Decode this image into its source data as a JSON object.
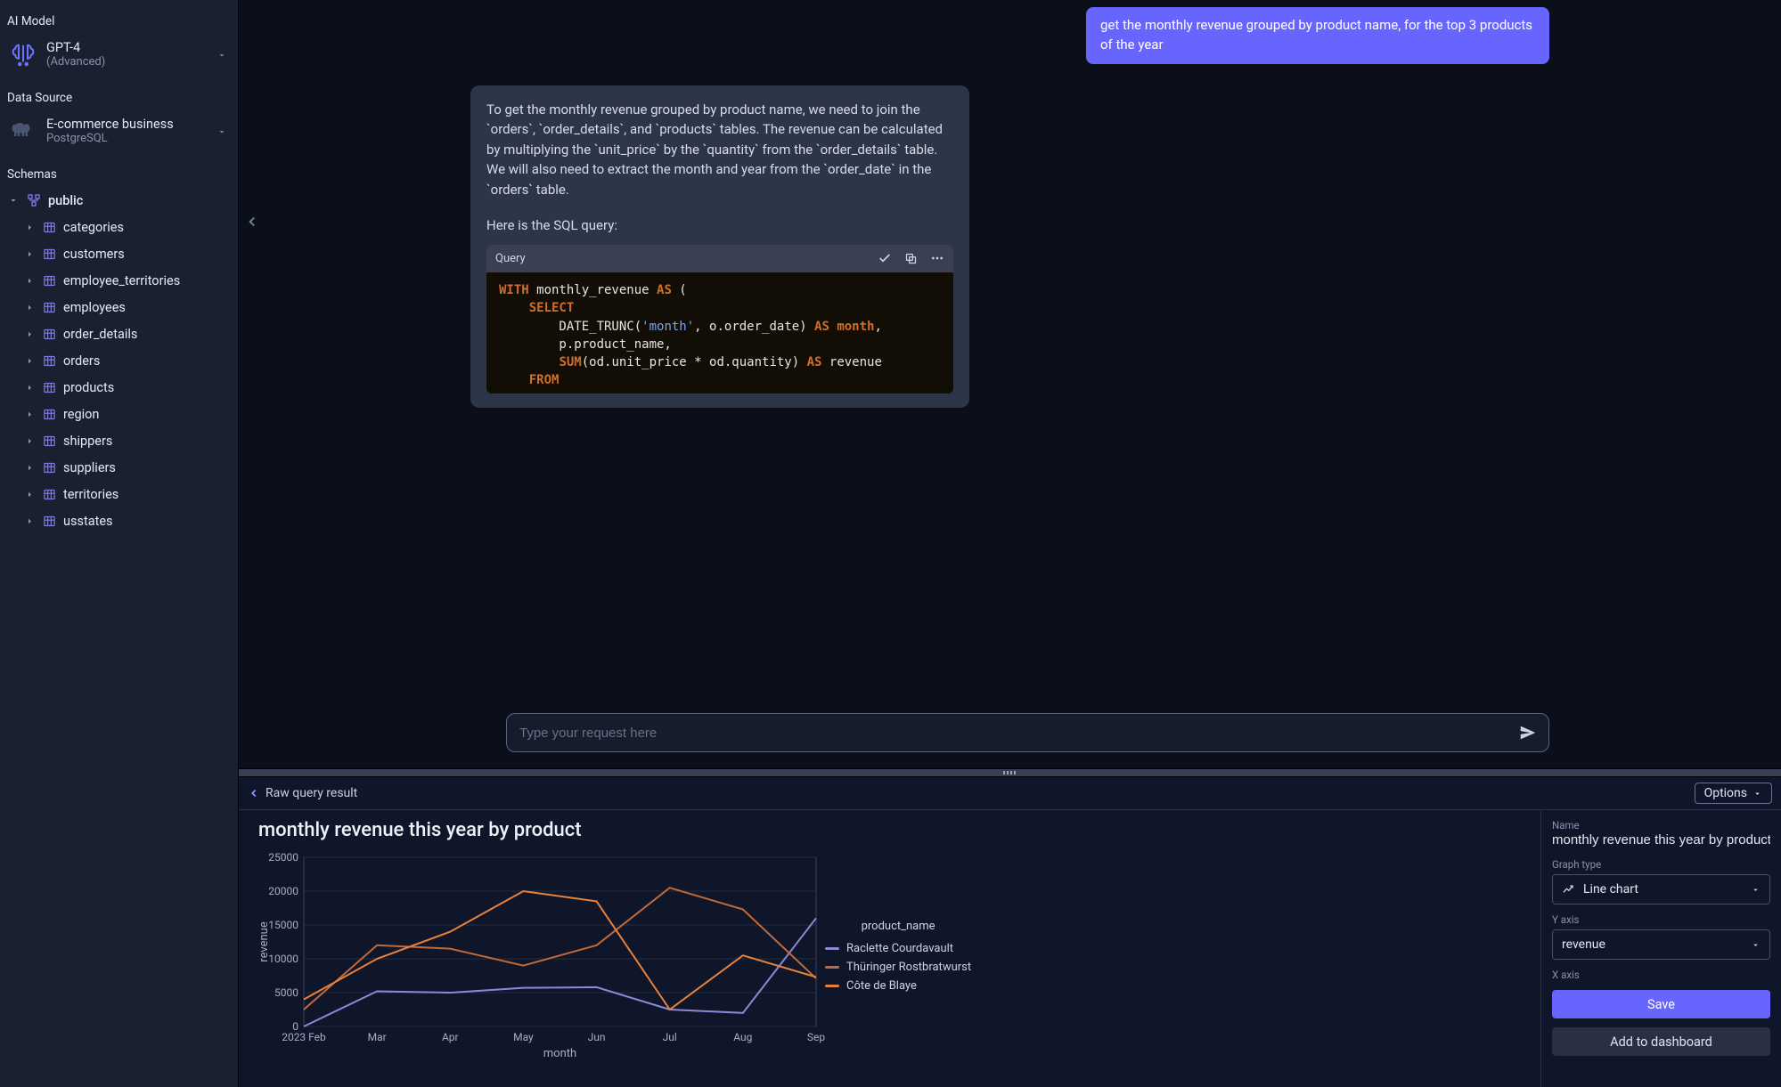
{
  "sidebar": {
    "ai_model": {
      "label": "AI Model",
      "name": "GPT-4",
      "sub": "(Advanced)"
    },
    "data_source": {
      "label": "Data Source",
      "name": "E-commerce business",
      "sub": "PostgreSQL"
    },
    "schemas": {
      "label": "Schemas",
      "schema_name": "public",
      "tables": [
        "categories",
        "customers",
        "employee_territories",
        "employees",
        "order_details",
        "orders",
        "products",
        "region",
        "shippers",
        "suppliers",
        "territories",
        "usstates"
      ]
    }
  },
  "chat": {
    "user_message": "get the monthly revenue grouped by product name, for the top 3 products of the year",
    "assistant_text_1": "To get the monthly revenue grouped by product name, we need to join the `orders`, `order_details`, and `products` tables. The revenue can be calculated by multiplying the `unit_price` by the `quantity` from the `order_details` table. We will also need to extract the month and year from the `order_date` in the `orders` table.",
    "assistant_text_2": "Here is the SQL query:",
    "query_label": "Query",
    "sql_tokens": [
      [
        "kw",
        "WITH"
      ],
      [
        "",
        " monthly_revenue "
      ],
      [
        "kw",
        "AS"
      ],
      [
        "",
        " ("
      ],
      [
        "nl",
        ""
      ],
      [
        "",
        "    "
      ],
      [
        "kw",
        "SELECT"
      ],
      [
        "nl",
        ""
      ],
      [
        "",
        "        DATE_TRUNC("
      ],
      [
        "str",
        "'month'"
      ],
      [
        "",
        ", o.order_date) "
      ],
      [
        "kw",
        "AS"
      ],
      [
        "",
        " "
      ],
      [
        "alias",
        "month"
      ],
      [
        "",
        ","
      ],
      [
        "nl",
        ""
      ],
      [
        "",
        "        p.product_name,"
      ],
      [
        "nl",
        ""
      ],
      [
        "",
        "        "
      ],
      [
        "kw",
        "SUM"
      ],
      [
        "",
        "(od.unit_price * od.quantity) "
      ],
      [
        "kw",
        "AS"
      ],
      [
        "",
        " revenue"
      ],
      [
        "nl",
        ""
      ],
      [
        "",
        "    "
      ],
      [
        "kw",
        "FROM"
      ]
    ],
    "composer_placeholder": "Type your request here"
  },
  "result": {
    "back_label": "Raw query result",
    "options_label": "Options",
    "config": {
      "name_label": "Name",
      "name_value": "monthly revenue this year by product",
      "graph_type_label": "Graph type",
      "graph_type_value": "Line chart",
      "y_label": "Y axis",
      "y_value": "revenue",
      "x_label": "X axis",
      "save_label": "Save",
      "add_dash_label": "Add to dashboard"
    }
  },
  "chart_data": {
    "type": "line",
    "title": "monthly revenue this year by product",
    "xlabel": "month",
    "ylabel": "revenue",
    "ylim": [
      0,
      25000
    ],
    "yticks": [
      0,
      5000,
      10000,
      15000,
      20000,
      25000
    ],
    "categories": [
      "2023 Feb",
      "Mar",
      "Apr",
      "May",
      "Jun",
      "Jul",
      "Aug",
      "Sep"
    ],
    "legend_title": "product_name",
    "series": [
      {
        "name": "Raclette Courdavault",
        "color": "#8b88d7",
        "values": [
          0,
          5200,
          5000,
          5700,
          5800,
          2500,
          2000,
          16000
        ]
      },
      {
        "name": "Thüringer Rostbratwurst",
        "color": "#e7823c",
        "values": [
          2500,
          12000,
          11500,
          9000,
          12000,
          20500,
          17300,
          7100
        ]
      },
      {
        "name": "Côte de Blaye",
        "color": "#e7823c",
        "values": [
          4000,
          10000,
          14000,
          20000,
          18500,
          2500,
          10500,
          7300
        ]
      }
    ],
    "series_colors": [
      "#8b88d7",
      "#c06a3a",
      "#e7823c"
    ]
  }
}
